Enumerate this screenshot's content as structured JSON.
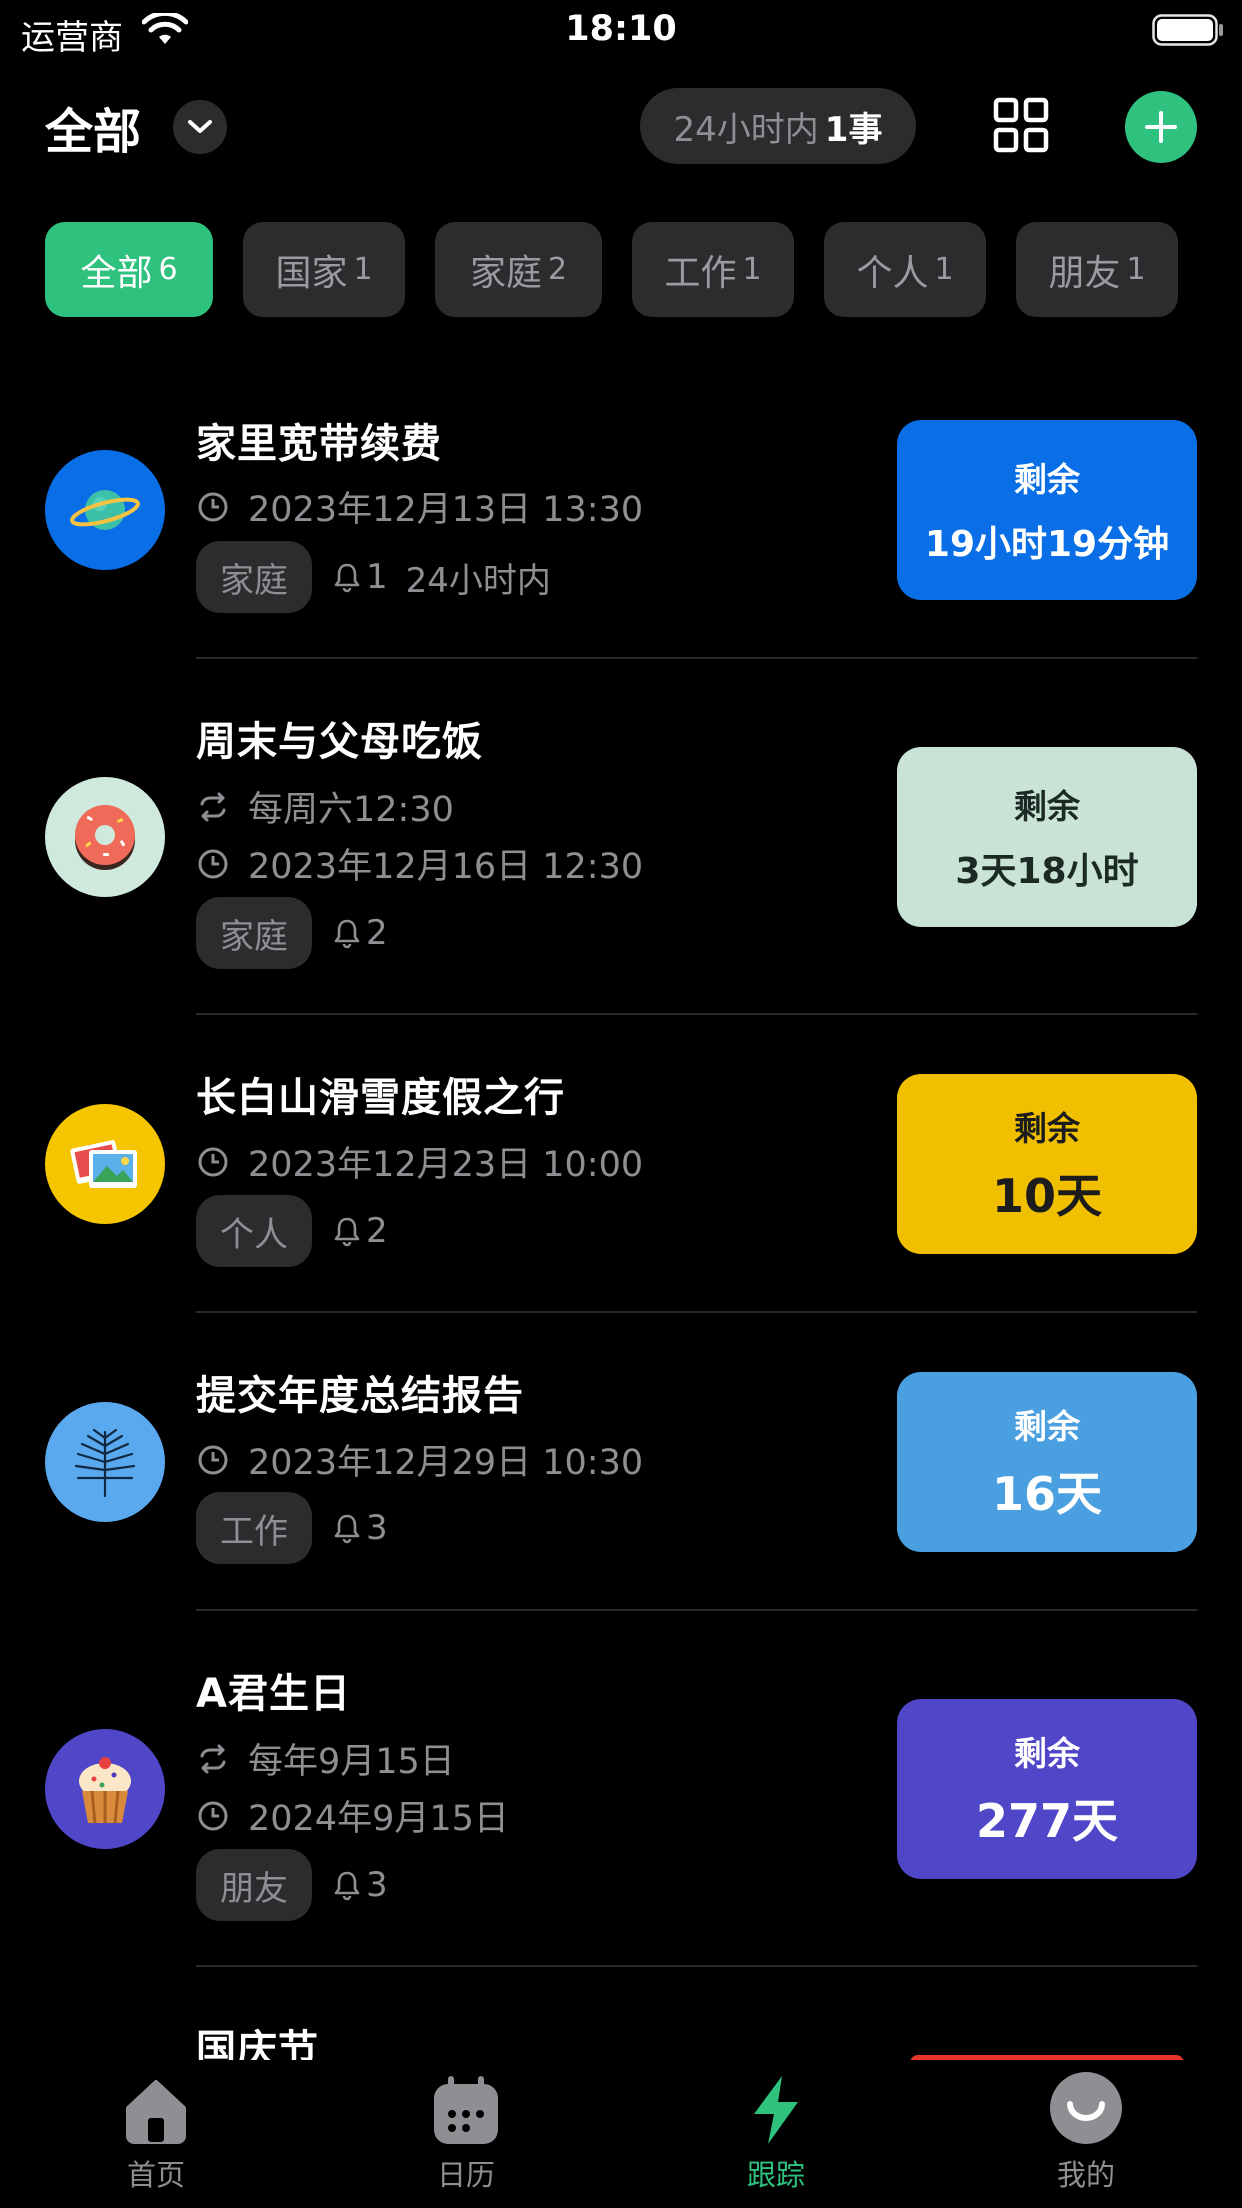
{
  "status_bar": {
    "carrier": "运营商",
    "time": "18:10"
  },
  "header": {
    "title": "全部",
    "pill_prefix": "24小时内",
    "pill_count": "1事"
  },
  "chips": [
    {
      "label": "全部",
      "count": "6"
    },
    {
      "label": "国家",
      "count": "1"
    },
    {
      "label": "家庭",
      "count": "2"
    },
    {
      "label": "工作",
      "count": "1"
    },
    {
      "label": "个人",
      "count": "1"
    },
    {
      "label": "朋友",
      "count": "1"
    }
  ],
  "items": [
    {
      "title": "家里宽带续费",
      "datetime": "2023年12月13日 13:30",
      "tag": "家庭",
      "bell": "1",
      "extra": "24小时内",
      "badge_label": "剩余",
      "badge_value": "19小时19分钟"
    },
    {
      "title": "周末与父母吃饭",
      "repeat": "每周六12:30",
      "datetime": "2023年12月16日 12:30",
      "tag": "家庭",
      "bell": "2",
      "badge_label": "剩余",
      "badge_value": "3天18小时"
    },
    {
      "title": "长白山滑雪度假之行",
      "datetime": "2023年12月23日 10:00",
      "tag": "个人",
      "bell": "2",
      "badge_label": "剩余",
      "badge_value": "10天"
    },
    {
      "title": "提交年度总结报告",
      "datetime": "2023年12月29日 10:30",
      "tag": "工作",
      "bell": "3",
      "badge_label": "剩余",
      "badge_value": "16天"
    },
    {
      "title": "A君生日",
      "repeat": "每年9月15日",
      "datetime": "2024年9月15日",
      "tag": "朋友",
      "bell": "3",
      "badge_label": "剩余",
      "badge_value": "277天"
    },
    {
      "title": "国庆节"
    }
  ],
  "tabbar": [
    {
      "label": "首页"
    },
    {
      "label": "日历"
    },
    {
      "label": "跟踪"
    },
    {
      "label": "我的"
    }
  ],
  "colors": {
    "accent": "#2ec27e",
    "badge_blue": "#0a6fe6",
    "badge_mint": "#c9e3d6",
    "badge_yellow": "#f0c000",
    "badge_skyblue": "#4a9fe0",
    "badge_purple": "#5046c8",
    "badge_red": "#e8352c"
  },
  "icons": {
    "item_1": "planet-icon",
    "item_2": "donut-icon",
    "item_3": "photos-icon",
    "item_4": "palm-leaf-icon",
    "item_5": "cupcake-icon"
  }
}
